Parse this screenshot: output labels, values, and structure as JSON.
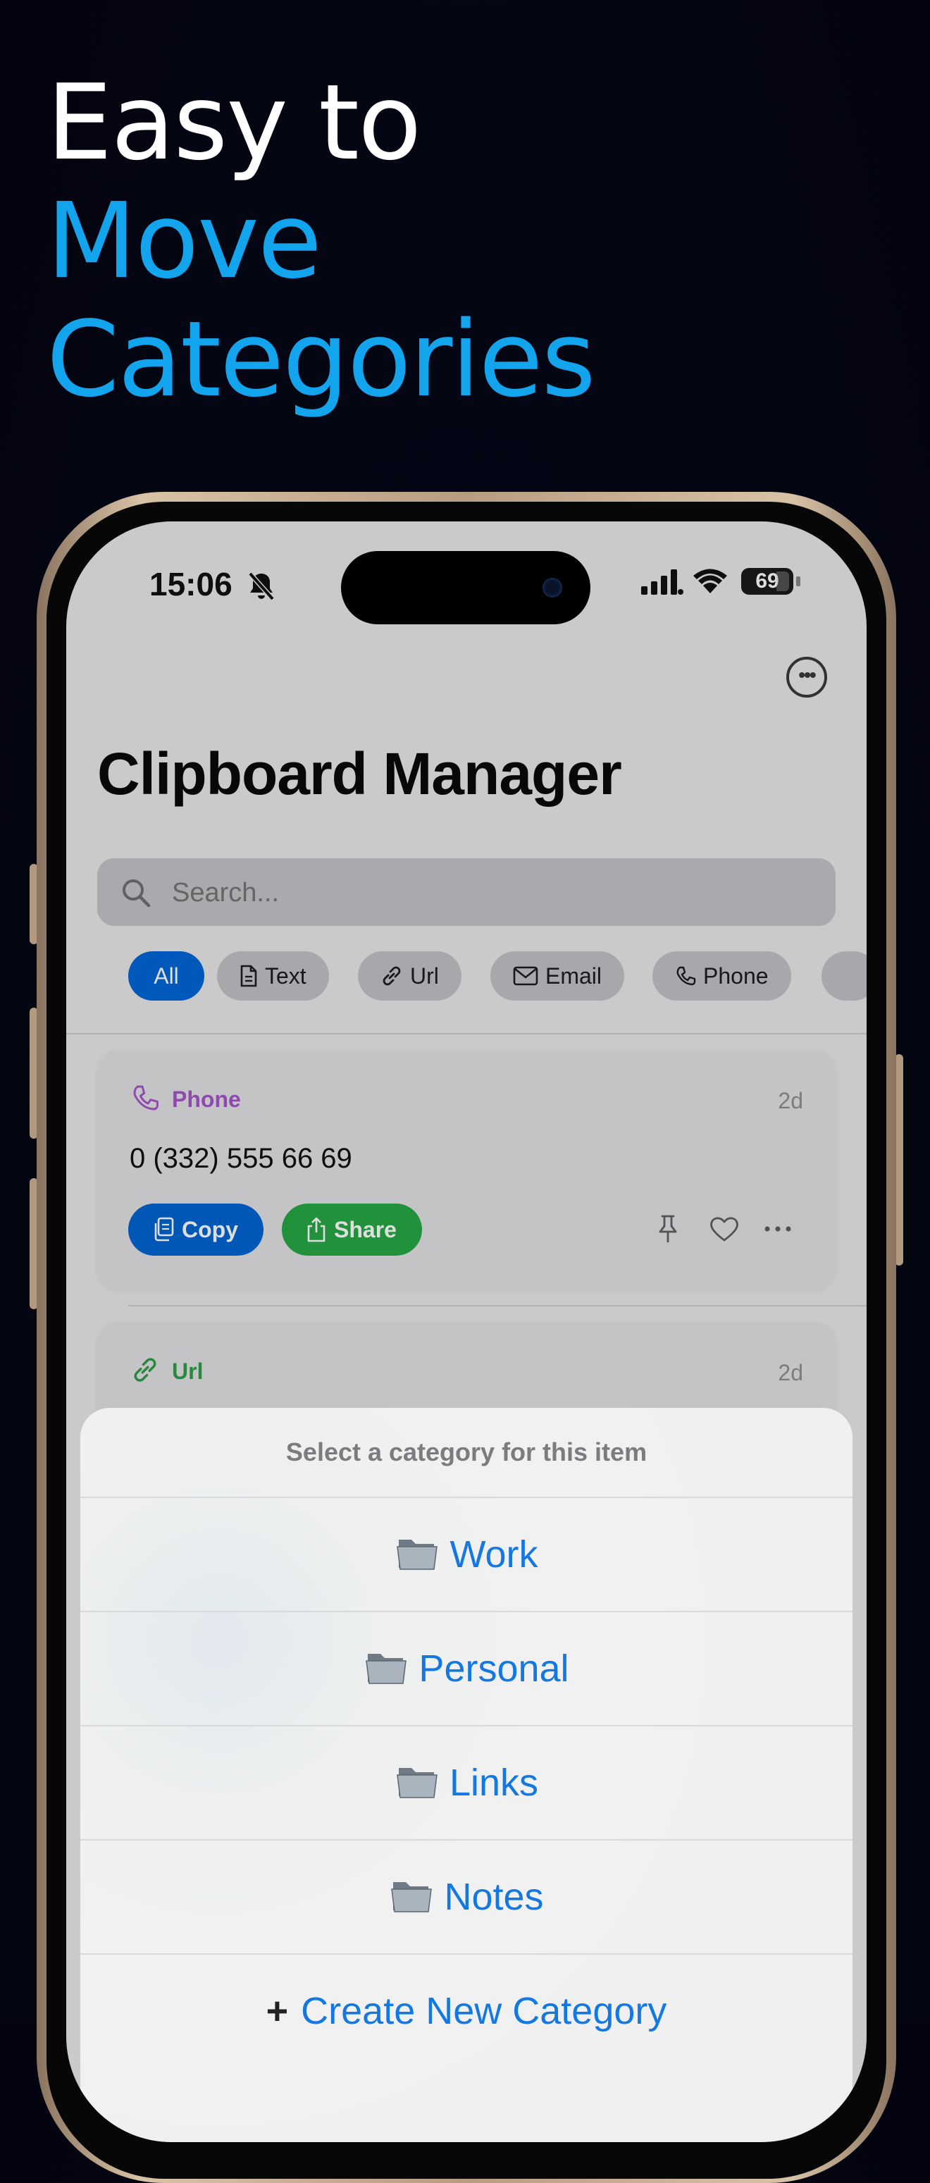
{
  "headline": {
    "line1": "Easy to",
    "line2": "Move",
    "line3": "Categories"
  },
  "status_bar": {
    "time": "15:06",
    "battery": "69"
  },
  "app": {
    "title": "Clipboard Manager",
    "search_placeholder": "Search..."
  },
  "filters": [
    {
      "label": "All",
      "icon": "none",
      "active": true
    },
    {
      "label": "Text",
      "icon": "document-icon"
    },
    {
      "label": "Url",
      "icon": "link-icon"
    },
    {
      "label": "Email",
      "icon": "envelope-icon"
    },
    {
      "label": "Phone",
      "icon": "phone-icon"
    }
  ],
  "cards": [
    {
      "type": "Phone",
      "age": "2d",
      "content": "0 (332) 555 66 69",
      "copy_label": "Copy",
      "share_label": "Share",
      "type_color": "#a356c6"
    },
    {
      "type": "Url",
      "age": "2d",
      "type_color": "#2e9e48"
    }
  ],
  "sheet": {
    "title": "Select a category for this item",
    "options": [
      "Work",
      "Personal",
      "Links",
      "Notes"
    ],
    "create_label": "Create New Category"
  },
  "colors": {
    "accent_blue": "#13a4ee",
    "link_blue": "#1478e2",
    "copy_blue": "#0064d2",
    "share_green": "#28a745"
  }
}
